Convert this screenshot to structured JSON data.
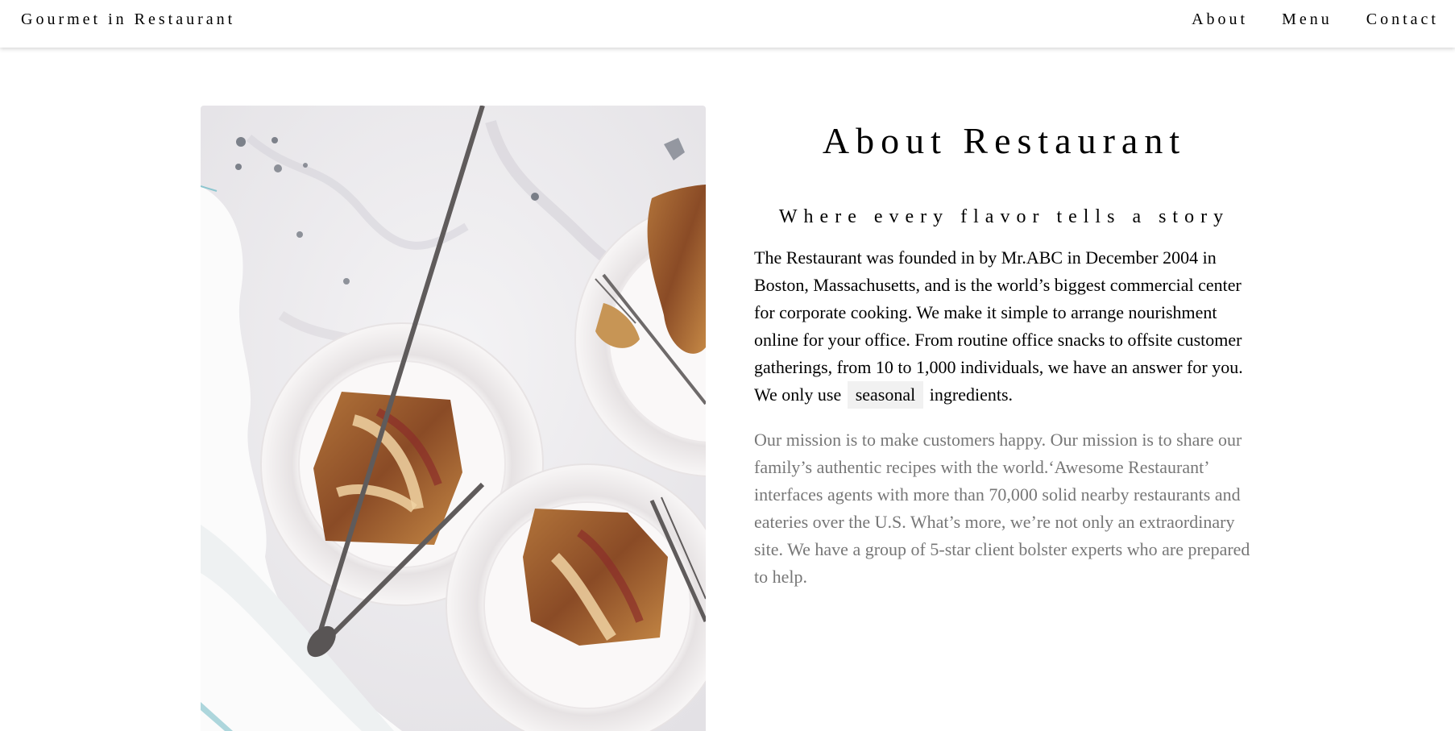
{
  "header": {
    "brand": "Gourmet in Restaurant",
    "nav": {
      "about": "About",
      "menu": "Menu",
      "contact": "Contact"
    }
  },
  "about": {
    "title": "About Restaurant",
    "tagline": "Where every flavor tells a story",
    "lead_before": "The Restaurant was founded in by Mr.ABC in December 2004 in Boston, Massachusetts, and is the world’s biggest commercial center for corporate cooking. We make it simple to arrange nourishment online for your office. From routine office snacks to offsite customer gatherings, from 10 to 1,000 individuals, we have an answer for you. We only use",
    "highlight": "seasonal",
    "lead_after": "ingredients.",
    "mission": "Our mission is to make customers happy. Our mission is to share our family’s authentic recipes with the world.‘Awesome Restaurant’ interfaces agents with more than 70,000 solid nearby restaurants and eateries over the U.S. What’s more, we’re not only an extraordinary site. We have a group of 5-star client bolster experts who are prepared to help."
  },
  "colors": {
    "background": "#ffffff",
    "text": "#000000",
    "muted_text": "#777777",
    "tag_background": "#f1f1f1"
  }
}
